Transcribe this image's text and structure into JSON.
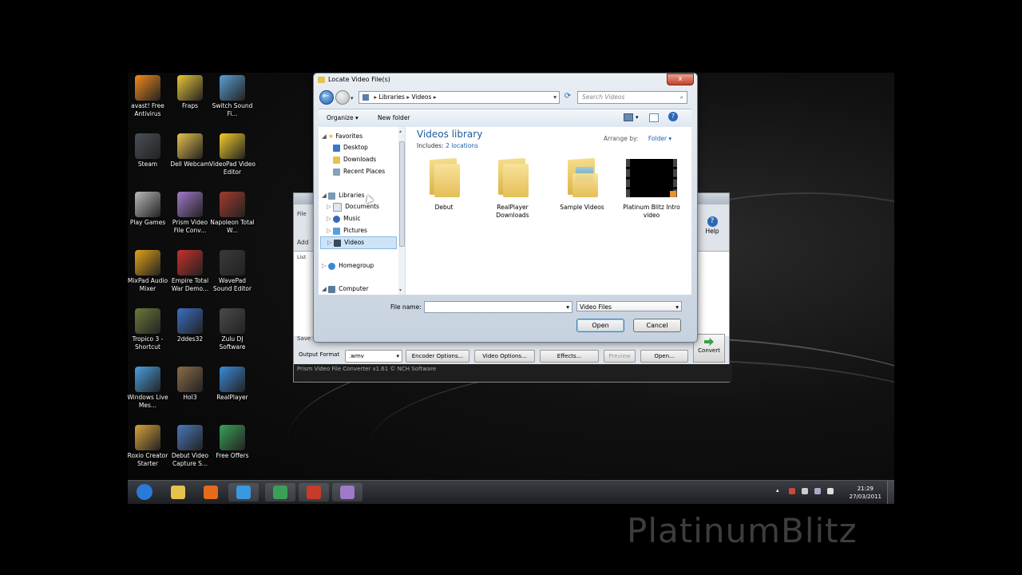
{
  "desktop_icons": [
    {
      "label": "avast! Free Antivirus",
      "color": "#f28a1a"
    },
    {
      "label": "Fraps",
      "color": "#e9c63a"
    },
    {
      "label": "Switch Sound Fi...",
      "color": "#5a9fd0"
    },
    {
      "label": "Steam",
      "color": "#4a4f58"
    },
    {
      "label": "Dell Webcam",
      "color": "#e6c24d"
    },
    {
      "label": "VideoPad Video Editor",
      "color": "#f2cd2a"
    },
    {
      "label": "Play Games",
      "color": "#b9b9b9"
    },
    {
      "label": "Prism Video File Conv...",
      "color": "#9f7ac9"
    },
    {
      "label": "Napoleon Total W...",
      "color": "#a33b2d"
    },
    {
      "label": "MixPad Audio Mixer",
      "color": "#e2a21a"
    },
    {
      "label": "Empire Total War Demo...",
      "color": "#c8302a"
    },
    {
      "label": "WavePad Sound Editor",
      "color": "#3a3a3a"
    },
    {
      "label": "Tropico 3 - Shortcut",
      "color": "#6a7a3b"
    },
    {
      "label": "2ddes32",
      "color": "#3a6fc4"
    },
    {
      "label": "Zulu DJ Software",
      "color": "#4a4a4a"
    },
    {
      "label": "Windows Live Mes...",
      "color": "#4aa0e0"
    },
    {
      "label": "HoI3",
      "color": "#8a6b4a"
    },
    {
      "label": "RealPlayer",
      "color": "#3a8ad8"
    },
    {
      "label": "Roxio Creator Starter",
      "color": "#d8a23a"
    },
    {
      "label": "Debut Video Capture S...",
      "color": "#4a78b8"
    },
    {
      "label": "Free Offers",
      "color": "#3aa058"
    }
  ],
  "taskbar": {
    "time": "21:29",
    "date": "27/03/2011",
    "buttons": [
      "start-orb",
      "explorer",
      "media-player",
      "internet-explorer",
      "live-messenger",
      "app-red",
      "prism-converter"
    ]
  },
  "background_app": {
    "title": "Prism Video File Converter v1.61 © NCH Software",
    "output_format_label": "Output Format",
    "output_format_value": ".wmv",
    "buttons": [
      "Encoder Options...",
      "Video Options...",
      "Effects...",
      "Preview",
      "Open..."
    ],
    "convert_label": "Convert",
    "help_label": "Help",
    "partial_labels": [
      "File",
      "Add",
      "List",
      "Save"
    ]
  },
  "dialog": {
    "title": "Locate Video File(s)",
    "breadcrumb": [
      "Libraries",
      "Videos"
    ],
    "search_placeholder": "Search Videos",
    "toolbar": {
      "organize": "Organize",
      "new_folder": "New folder"
    },
    "nav": {
      "favorites": "Favorites",
      "favorites_items": [
        "Desktop",
        "Downloads",
        "Recent Places"
      ],
      "libraries": "Libraries",
      "library_items": [
        "Documents",
        "Music",
        "Pictures",
        "Videos"
      ],
      "homegroup": "Homegroup",
      "computer": "Computer"
    },
    "library_title": "Videos library",
    "includes_label": "Includes:",
    "includes_link": "2 locations",
    "arrange_by_label": "Arrange by:",
    "arrange_by_value": "Folder",
    "files": [
      {
        "name": "Debut",
        "kind": "folder"
      },
      {
        "name": "RealPlayer Downloads",
        "kind": "folder"
      },
      {
        "name": "Sample Videos",
        "kind": "folder"
      },
      {
        "name": "Platinum Blitz Intro video",
        "kind": "video"
      }
    ],
    "file_name_label": "File name:",
    "file_name_value": "",
    "file_type_value": "Video Files",
    "open_label": "Open",
    "cancel_label": "Cancel",
    "close_glyph": "x"
  },
  "watermark": "PlatinumBlitz"
}
